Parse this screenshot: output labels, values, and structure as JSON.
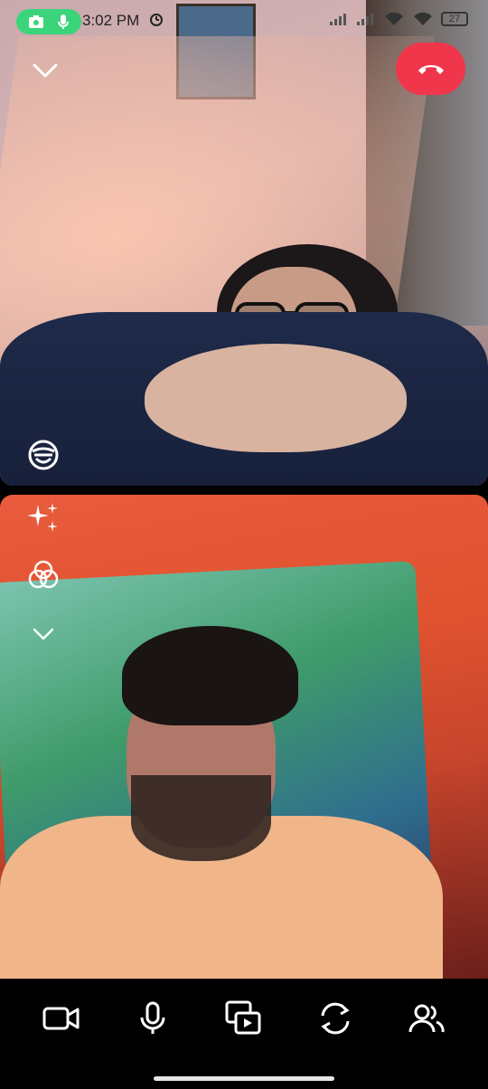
{
  "status_bar": {
    "time": "3:02 PM",
    "battery": "27"
  },
  "icons": {
    "camera_indicator": "camera-icon",
    "mic_indicator": "mic-icon",
    "alarm": "alarm-icon",
    "collapse": "chevron-down-icon",
    "end_call": "phone-hangup-icon",
    "effects": "face-effects-icon",
    "sparkle": "sparkle-icon",
    "filters": "filter-circles-icon",
    "more": "chevron-down-icon",
    "video": "video-camera-icon",
    "microphone": "microphone-icon",
    "media": "media-share-icon",
    "flip": "flip-camera-icon",
    "participants": "participants-icon"
  },
  "colors": {
    "recording_pill": "#3bd47a",
    "end_call": "#f0364a",
    "toolbar_bg": "#000000"
  }
}
